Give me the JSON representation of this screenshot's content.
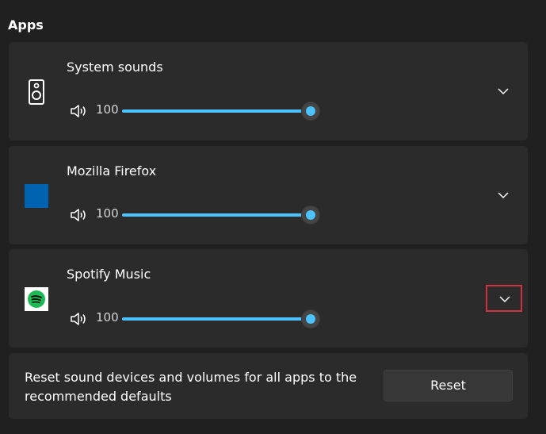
{
  "section": {
    "title": "Apps"
  },
  "apps": [
    {
      "name": "System sounds",
      "icon": "speaker-device-icon",
      "volume": 100,
      "volume_fraction": 1.0
    },
    {
      "name": "Mozilla Firefox",
      "icon": "firefox-app-icon",
      "volume": 100,
      "volume_fraction": 1.0
    },
    {
      "name": "Spotify Music",
      "icon": "spotify-icon",
      "volume": 100,
      "volume_fraction": 1.0
    }
  ],
  "reset": {
    "description": "Reset sound devices and volumes for all apps to the recommended defaults",
    "button_label": "Reset"
  },
  "colors": {
    "background": "#202020",
    "card": "#2b2b2b",
    "accent": "#4cc2ff",
    "highlight_border": "#d1303f",
    "firefox_tile": "#0063b1",
    "spotify_green": "#1db954"
  }
}
